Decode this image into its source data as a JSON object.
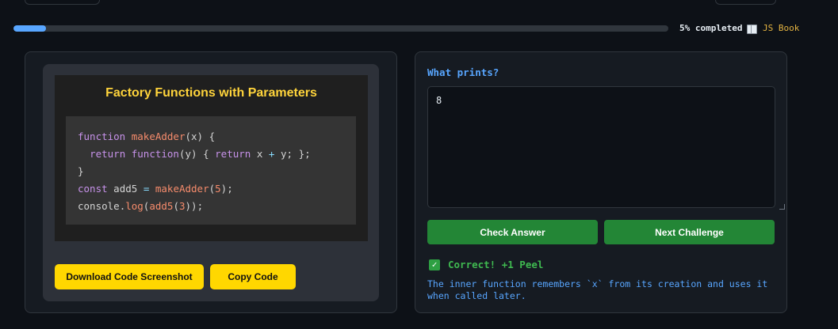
{
  "progress": {
    "percent": 5,
    "label": "5% completed",
    "book_icon": "book-icon",
    "book_link": "JS Book"
  },
  "snippet": {
    "title": "Factory Functions with Parameters",
    "code_lines": [
      "function makeAdder(x) {",
      "  return function(y) { return x + y; };",
      "}",
      "const add5 = makeAdder(5);",
      "console.log(add5(3));"
    ],
    "download_label": "Download Code Screenshot",
    "copy_label": "Copy Code"
  },
  "quiz": {
    "question": "What prints?",
    "answer_value": "8",
    "check_label": "Check Answer",
    "next_label": "Next Challenge",
    "feedback_icon": "check-mark-icon",
    "feedback": "Correct! +1 Peel",
    "explanation": "The inner function remembers `x` from its creation and uses it when called later."
  },
  "colors": {
    "accent_blue": "#58a6ff",
    "success_green": "#238636",
    "button_yellow": "#ffd700",
    "title_yellow": "#ffd43b"
  }
}
